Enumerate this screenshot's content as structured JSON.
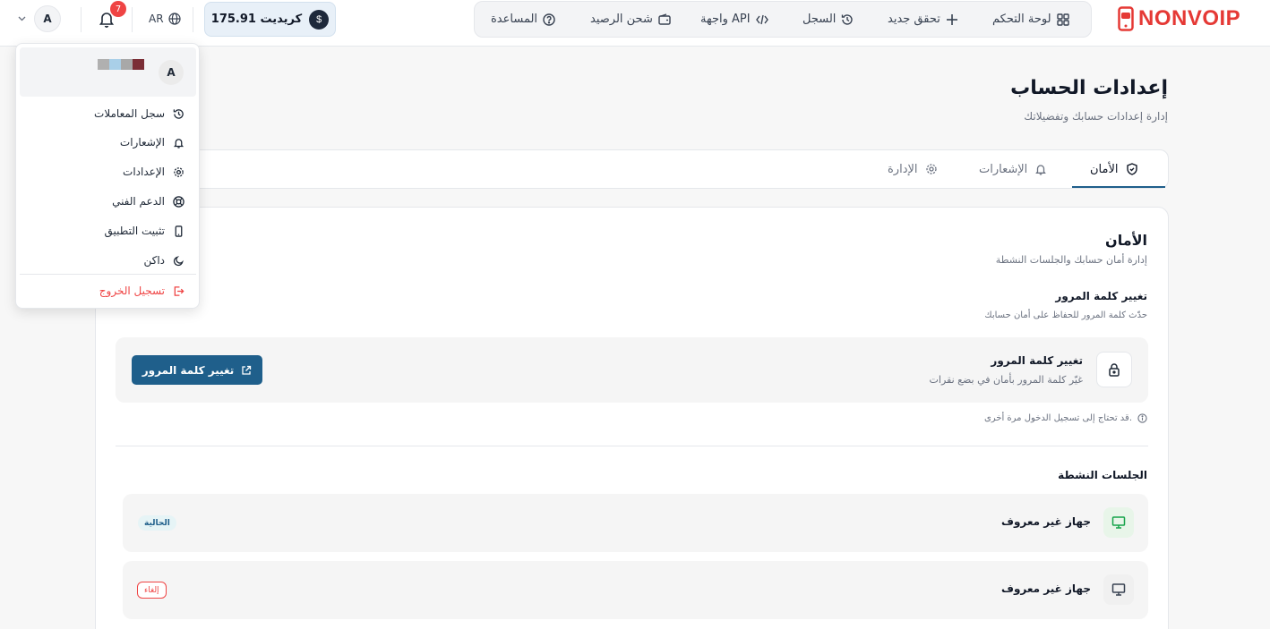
{
  "brand": {
    "logo_text": "NONVOIP",
    "accent": "#e53935",
    "primary": "#1f5f8b"
  },
  "nav": {
    "items": [
      {
        "label": "لوحة التحكم",
        "icon": "grid-icon"
      },
      {
        "label": "تحقق جديد",
        "icon": "plus-icon"
      },
      {
        "label": "السجل",
        "icon": "history-icon"
      },
      {
        "label": "واجهة API",
        "icon": "code-icon"
      },
      {
        "label": "شحن الرصيد",
        "icon": "wallet-icon"
      },
      {
        "label": "المساعدة",
        "icon": "help-circle-icon"
      }
    ]
  },
  "header": {
    "credit_symbol": "$",
    "credit_text": "175.91 كريديت",
    "language": "AR",
    "notification_count": "7",
    "avatar_initial": "A"
  },
  "page": {
    "title": "إعدادات الحساب",
    "subtitle": "إدارة إعدادات حسابك وتفضيلاتك"
  },
  "tabs": [
    {
      "label": "الأمان",
      "icon": "shield-icon",
      "active": true
    },
    {
      "label": "الإشعارات",
      "icon": "bell-icon",
      "active": false
    },
    {
      "label": "الإدارة",
      "icon": "gear-icon",
      "active": false
    }
  ],
  "security": {
    "title": "الأمان",
    "subtitle": "إدارة أمان حسابك والجلسات النشطة",
    "password": {
      "title": "تغيير كلمة المرور",
      "subtitle": "حدّث كلمة المرور للحفاظ على أمان حسابك",
      "row_title": "تغيير كلمة المرور",
      "row_subtitle": "غيّر كلمة المرور بأمان في بضع نقرات",
      "button_label": "تغيير كلمة المرور",
      "note": "قد تحتاج إلى تسجيل الدخول مرة أخرى."
    },
    "sessions_title": "الجلسات النشطة",
    "sessions": [
      {
        "device": "جهاز غير معروف",
        "badge": "الحالية",
        "icon_color": "#16a34a"
      },
      {
        "device": "جهاز غير معروف",
        "action": "إلغاء",
        "icon_color": "#374151"
      }
    ]
  },
  "user_menu": {
    "avatar_initial": "A",
    "items": [
      {
        "label": "سجل المعاملات",
        "icon": "history-icon"
      },
      {
        "label": "الإشعارات",
        "icon": "bell-icon"
      },
      {
        "label": "الإعدادات",
        "icon": "gear-icon"
      },
      {
        "label": "الدعم الفني",
        "icon": "lifebuoy-icon"
      },
      {
        "label": "تثبيت التطبيق",
        "icon": "smartphone-icon"
      },
      {
        "label": "داكن",
        "icon": "moon-icon"
      }
    ],
    "logout_label": "تسجيل الخروج",
    "logout_icon": "logout-icon"
  }
}
